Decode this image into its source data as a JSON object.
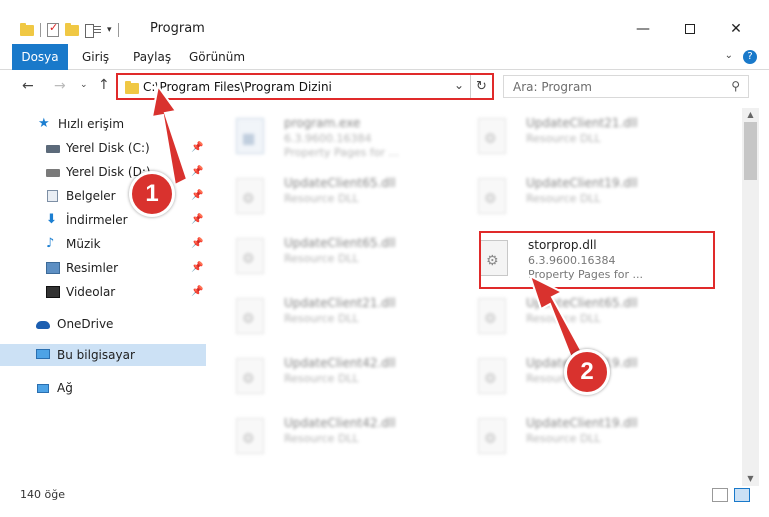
{
  "window": {
    "title": "Program"
  },
  "ribbon": {
    "tabs": [
      "Dosya",
      "Giriş",
      "Paylaş",
      "Görünüm"
    ]
  },
  "address": {
    "path": "C:\\Program Files\\Program Dizini",
    "search_placeholder": "Ara: Program"
  },
  "nav": {
    "items": [
      {
        "label": "Hızlı erişim",
        "icon": "star-icon"
      },
      {
        "label": "Yerel Disk (C:)",
        "icon": "disk-icon",
        "pinned": true
      },
      {
        "label": "Yerel Disk (D:)",
        "icon": "disk-icon",
        "pinned": true
      },
      {
        "label": "Belgeler",
        "icon": "documents-icon",
        "pinned": true
      },
      {
        "label": "İndirmeler",
        "icon": "downloads-icon",
        "pinned": true
      },
      {
        "label": "Müzik",
        "icon": "music-icon",
        "pinned": true
      },
      {
        "label": "Resimler",
        "icon": "pictures-icon",
        "pinned": true
      },
      {
        "label": "Videolar",
        "icon": "videos-icon",
        "pinned": true
      },
      {
        "label": "OneDrive",
        "icon": "onedrive-icon"
      },
      {
        "label": "Bu bilgisayar",
        "icon": "computer-icon",
        "selected": true
      },
      {
        "label": "Ağ",
        "icon": "network-icon"
      }
    ]
  },
  "files": [
    {
      "name": "program.exe",
      "desc": "6.3.9600.16384",
      "desc2": "Property Pages for ...",
      "blurred": true,
      "type": "exe"
    },
    {
      "name": "UpdateClient21.dll",
      "desc": "Resource DLL",
      "blurred": true
    },
    {
      "name": "UpdateClient65.dll",
      "desc": "Resource DLL",
      "blurred": true
    },
    {
      "name": "UpdateClient19.dll",
      "desc": "Resource DLL",
      "blurred": true
    },
    {
      "name": "UpdateClient65.dll",
      "desc": "Resource DLL",
      "blurred": true
    },
    {
      "name": "storprop.dll",
      "desc": "6.3.9600.16384",
      "desc2": "Property Pages for ...",
      "blurred": false
    },
    {
      "name": "UpdateClient21.dll",
      "desc": "Resource DLL",
      "blurred": true
    },
    {
      "name": "UpdateClient65.dll",
      "desc": "Resource DLL",
      "blurred": true
    },
    {
      "name": "UpdateClient42.dll",
      "desc": "Resource DLL",
      "blurred": true
    },
    {
      "name": "UpdateClient19.dll",
      "desc": "Resource DLL",
      "blurred": true
    },
    {
      "name": "UpdateClient42.dll",
      "desc": "Resource DLL",
      "blurred": true
    },
    {
      "name": "UpdateClient19.dll",
      "desc": "Resource DLL",
      "blurred": true
    }
  ],
  "status": {
    "count": "140 öğe"
  },
  "callouts": [
    "1",
    "2"
  ],
  "colors": {
    "accent": "#1979ca",
    "highlight": "#e02a2a",
    "callout": "#d9322e"
  }
}
